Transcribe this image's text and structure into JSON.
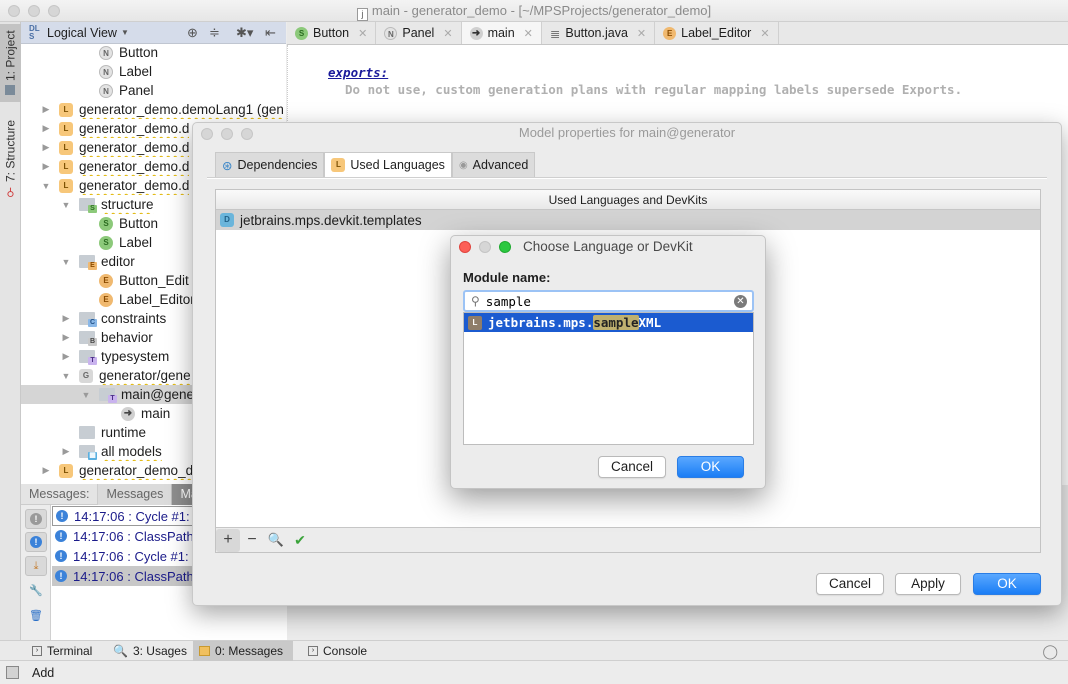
{
  "window": {
    "title": "main - generator_demo - [~/MPSProjects/generator_demo]",
    "title_icon": "j"
  },
  "left_strip": {
    "project_tab": "1: Project",
    "structure_tab": "7: Structure"
  },
  "project_panel": {
    "view_label": "Logical View",
    "tree": [
      {
        "label": "Button",
        "icon": "N"
      },
      {
        "label": "Label",
        "icon": "N"
      },
      {
        "label": "Panel",
        "icon": "N"
      },
      {
        "label": "generator_demo.demoLang1 (gen",
        "icon": "L"
      },
      {
        "label": "generator_demo.d",
        "icon": "L"
      },
      {
        "label": "generator_demo.d",
        "icon": "L"
      },
      {
        "label": "generator_demo.d",
        "icon": "L"
      },
      {
        "label": "generator_demo.d",
        "icon": "L"
      },
      {
        "label": "structure",
        "icon": "S-folder"
      },
      {
        "label": "Button",
        "icon": "S"
      },
      {
        "label": "Label",
        "icon": "S"
      },
      {
        "label": "editor",
        "icon": "E-folder"
      },
      {
        "label": "Button_Edit",
        "icon": "E"
      },
      {
        "label": "Label_Editor",
        "icon": "E"
      },
      {
        "label": "constraints",
        "icon": "C-folder"
      },
      {
        "label": "behavior",
        "icon": "B-folder"
      },
      {
        "label": "typesystem",
        "icon": "T-folder"
      },
      {
        "label": "generator/gene",
        "icon": "G"
      },
      {
        "label": "main@gene",
        "icon": "T-folder"
      },
      {
        "label": "main",
        "icon": "run"
      },
      {
        "label": "runtime",
        "icon": "folder"
      },
      {
        "label": "all models",
        "icon": "models-folder"
      },
      {
        "label": "generator_demo_d",
        "icon": "L"
      }
    ]
  },
  "editor": {
    "tabs": [
      {
        "label": "Button",
        "icon": "S",
        "active": false
      },
      {
        "label": "Panel",
        "icon": "N",
        "active": false
      },
      {
        "label": "main",
        "icon": "run",
        "active": true
      },
      {
        "label": "Button.java",
        "icon": "file",
        "active": false
      },
      {
        "label": "Label_Editor",
        "icon": "E",
        "active": false
      }
    ],
    "keyword": "exports:",
    "comment": "Do not use, custom generation plans with regular mapping labels supersede Exports."
  },
  "messages": {
    "label": "Messages:",
    "tabs": [
      "Messages",
      "Make"
    ],
    "rows": [
      "14:17:06 : Cycle #1:",
      "14:17:06 : ClassPath",
      "14:17:06 : Cycle #1:",
      "14:17:06 : ClassPath"
    ]
  },
  "bottom_tabs": [
    {
      "label": "Terminal",
      "icon": "terminal"
    },
    {
      "label": "3: Usages",
      "icon": "search"
    },
    {
      "label": "0: Messages",
      "icon": "messages",
      "active": true
    },
    {
      "label": "Console",
      "icon": "console"
    }
  ],
  "status": {
    "text": "Add"
  },
  "model_dialog": {
    "title": "Model properties for main@generator",
    "tabs": [
      {
        "label": "Dependencies",
        "active": false
      },
      {
        "label": "Used Languages",
        "active": true
      },
      {
        "label": "Advanced",
        "active": false
      }
    ],
    "table_header": "Used Languages and DevKits",
    "rows": [
      {
        "label": "jetbrains.mps.devkit.templates",
        "icon": "D"
      }
    ],
    "buttons": {
      "cancel": "Cancel",
      "apply": "Apply",
      "ok": "OK"
    }
  },
  "choose_dialog": {
    "title": "Choose Language or DevKit",
    "field_label": "Module name:",
    "search_value": "sample",
    "result": {
      "prefix": "jetbrains.mps.",
      "match": "sample",
      "suffix": "XML",
      "icon": "L"
    },
    "buttons": {
      "cancel": "Cancel",
      "ok": "OK"
    }
  }
}
